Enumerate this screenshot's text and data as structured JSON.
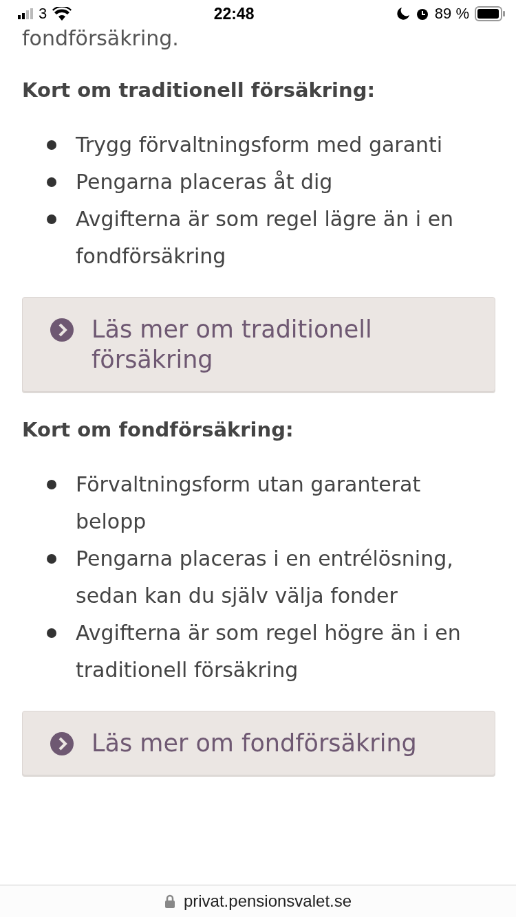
{
  "status_bar": {
    "carrier": "3",
    "time": "22:48",
    "battery": "89 %"
  },
  "intro_tail": "fondförsäkring.",
  "sections": [
    {
      "heading": "Kort om traditionell försäkring:",
      "bullets": [
        "Trygg förvaltningsform med garanti",
        "Pengarna placeras åt dig",
        "Avgifterna är som regel lägre än i en fondförsäkring"
      ],
      "link": "Läs mer om traditionell försäkring"
    },
    {
      "heading": "Kort om fondförsäkring:",
      "bullets": [
        "Förvaltningsform utan garanterat belopp",
        "Pengarna placeras i en entrélösning, sedan kan du själv välja fonder",
        "Avgifterna är som regel högre än i en traditionell försäkring"
      ],
      "link": "Läs mer om fondförsäkring"
    }
  ],
  "address_bar": {
    "url": "privat.pensionsvalet.se"
  }
}
